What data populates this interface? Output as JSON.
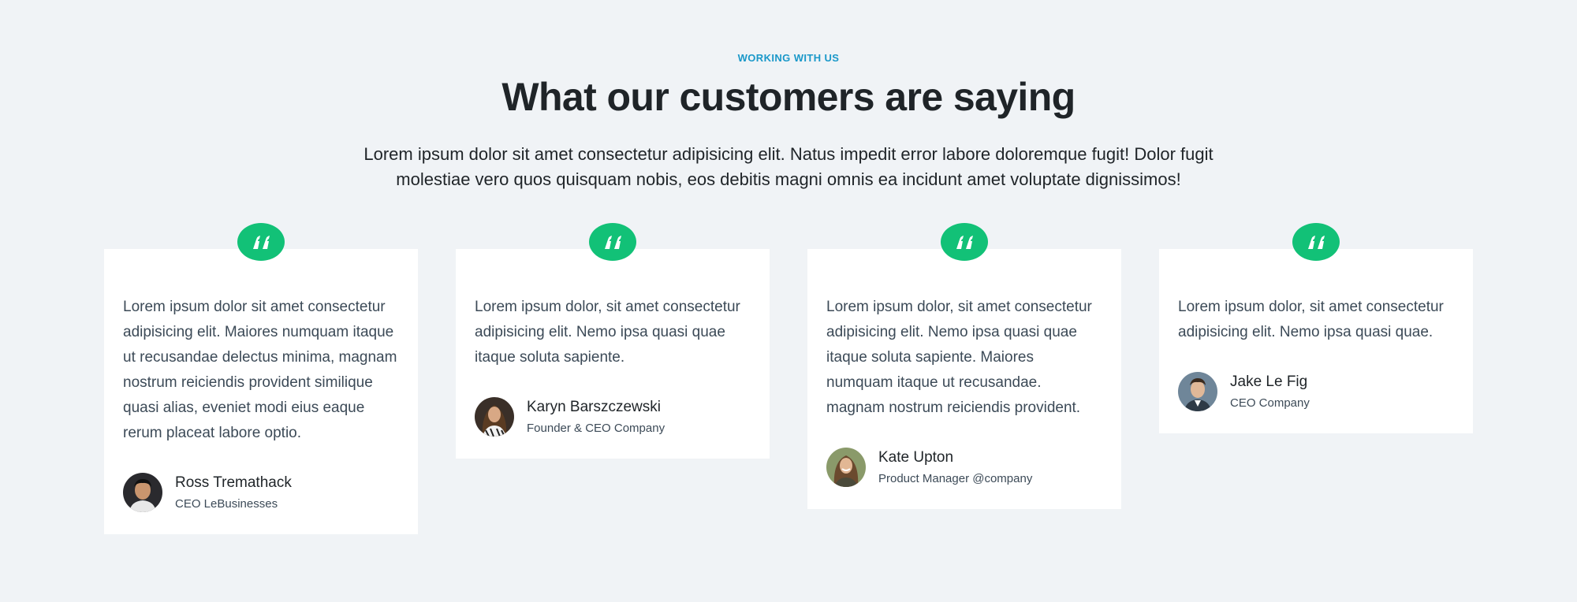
{
  "header": {
    "eyebrow": "WORKING WITH US",
    "title": "What our customers are saying",
    "subtitle": "Lorem ipsum dolor sit amet consectetur adipisicing elit. Natus impedit error labore doloremque fugit! Dolor fugit molestiae vero quos quisquam nobis, eos debitis magni omnis ea incidunt amet voluptate dignissimos!"
  },
  "colors": {
    "accent": "#1a98c9",
    "quote_badge": "#12c177",
    "background": "#f0f3f6",
    "card": "#ffffff"
  },
  "testimonials": [
    {
      "text": "Lorem ipsum dolor sit amet consectetur adipisicing elit. Maiores numquam itaque ut recusandae delectus minima, magnam nostrum reiciendis provident similique quasi alias, eveniet modi eius eaque rerum placeat labore optio.",
      "name": "Ross Tremathack",
      "role": "CEO LeBusinesses",
      "icon": "quote-icon"
    },
    {
      "text": "Lorem ipsum dolor, sit amet consectetur adipisicing elit. Nemo ipsa quasi quae itaque soluta sapiente.",
      "name": "Karyn Barszczewski",
      "role": "Founder & CEO Company",
      "icon": "quote-icon"
    },
    {
      "text": "Lorem ipsum dolor, sit amet consectetur adipisicing elit. Nemo ipsa quasi quae itaque soluta sapiente. Maiores numquam itaque ut recusandae. magnam nostrum reiciendis provident.",
      "name": "Kate Upton",
      "role": "Product Manager @company",
      "icon": "quote-icon"
    },
    {
      "text": "Lorem ipsum dolor, sit amet consectetur adipisicing elit. Nemo ipsa quasi quae.",
      "name": "Jake Le Fig",
      "role": "CEO Company",
      "icon": "quote-icon"
    }
  ]
}
